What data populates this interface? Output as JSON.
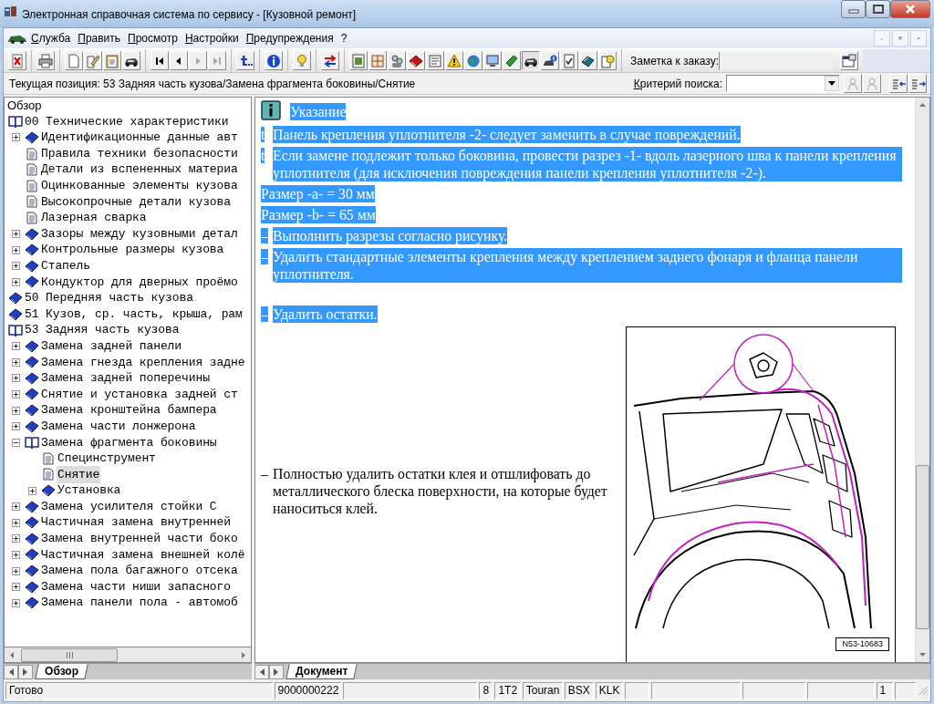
{
  "window": {
    "title": "Электронная справочная система по сервису - [Кузовной ремонт]"
  },
  "menu": [
    {
      "label": "Служба"
    },
    {
      "label": "Править"
    },
    {
      "label": "Просмотр"
    },
    {
      "label": "Настройки"
    },
    {
      "label": "Предупреждения"
    },
    {
      "label": "?"
    }
  ],
  "order_note": {
    "label": "Заметка к заказу:"
  },
  "position_bar": {
    "text": "Текущая позиция: 53 Задняя часть кузова/Замена фрагмента боковины/Снятие",
    "search_label": "Критерий поиска:"
  },
  "tree": {
    "header": "Обзор",
    "items": [
      {
        "label": "00 Технические характеристики",
        "kind": "book",
        "expanded": true,
        "selected": false,
        "children": [
          {
            "label": "Идентификационные данные авт",
            "kind": "book",
            "expanded": false,
            "selected": false
          },
          {
            "label": "Правила техники безопасности",
            "kind": "page",
            "selected": false
          },
          {
            "label": "Детали из вспененных материа",
            "kind": "page",
            "selected": false
          },
          {
            "label": "Оцинкованные элементы кузова",
            "kind": "page",
            "selected": false
          },
          {
            "label": "Высокопрочные детали кузова",
            "kind": "page",
            "selected": false
          },
          {
            "label": "Лазерная сварка",
            "kind": "page",
            "selected": false
          },
          {
            "label": "Зазоры между кузовными детал",
            "kind": "book",
            "expanded": false,
            "selected": false
          },
          {
            "label": "Контрольные размеры кузова",
            "kind": "book",
            "expanded": false,
            "selected": false
          },
          {
            "label": "Стапель",
            "kind": "book",
            "expanded": false,
            "selected": false
          },
          {
            "label": "Кондуктор для дверных проёмо",
            "kind": "book",
            "expanded": false,
            "selected": false
          }
        ]
      },
      {
        "label": "50 Передняя часть кузова",
        "kind": "book",
        "expanded": false,
        "selected": false
      },
      {
        "label": "51 Кузов, ср. часть, крыша, рам",
        "kind": "book",
        "expanded": false,
        "selected": false
      },
      {
        "label": "53 Задняя часть кузова",
        "kind": "book",
        "expanded": true,
        "selected": false,
        "children": [
          {
            "label": "Замена задней панели",
            "kind": "book",
            "expanded": false,
            "selected": false
          },
          {
            "label": "Замена гнезда крепления задне",
            "kind": "book",
            "expanded": false,
            "selected": false
          },
          {
            "label": "Замена задней поперечины",
            "kind": "book",
            "expanded": false,
            "selected": false
          },
          {
            "label": "Снятие и установка задней ст",
            "kind": "book",
            "expanded": false,
            "selected": false
          },
          {
            "label": "Замена кронштейна бампера",
            "kind": "book",
            "expanded": false,
            "selected": false
          },
          {
            "label": "Замена части лонжерона",
            "kind": "book",
            "expanded": false,
            "selected": false
          },
          {
            "label": "Замена фрагмента боковины",
            "kind": "book",
            "expanded": true,
            "selected": false,
            "children": [
              {
                "label": "Специнструмент",
                "kind": "page",
                "selected": false
              },
              {
                "label": "Снятие",
                "kind": "page",
                "selected": true
              },
              {
                "label": "Установка",
                "kind": "book",
                "expanded": false,
                "selected": false
              }
            ]
          },
          {
            "label": "Замена усилителя стойки С",
            "kind": "book",
            "expanded": false,
            "selected": false
          },
          {
            "label": "Частичная замена внутренней",
            "kind": "book",
            "expanded": false,
            "selected": false
          },
          {
            "label": "Замена внутренней части боко",
            "kind": "book",
            "expanded": false,
            "selected": false
          },
          {
            "label": "Частичная замена внешней колё",
            "kind": "book",
            "expanded": false,
            "selected": false
          },
          {
            "label": "Замена пола багажного отсека",
            "kind": "book",
            "expanded": false,
            "selected": false
          },
          {
            "label": "Замена части ниши запасного",
            "kind": "book",
            "expanded": false,
            "selected": false
          },
          {
            "label": "Замена панели пола - автомоб",
            "kind": "book",
            "expanded": false,
            "selected": false
          }
        ]
      }
    ]
  },
  "left_tab": {
    "label": "Обзор",
    "selected": true
  },
  "content": {
    "note_heading": {
      "text": "Указание",
      "selected": true
    },
    "blocks": [
      {
        "kind": "bullet",
        "marker": "t",
        "text": "Панель крепления уплотнителя -2- следует заменить в случае повреждений.",
        "selected": true
      },
      {
        "kind": "bullet",
        "marker": "t",
        "text": "Если замене подлежит только боковина, провести разрез -1- вдоль лазерного шва к панели крепления уплотнителя (для исключения повреждения панели крепления уплотнителя -2-).",
        "selected": true
      },
      {
        "kind": "plain",
        "text": "Размер -a- = 30 мм",
        "selected": true
      },
      {
        "kind": "plain",
        "text": "Размер -b- = 65 мм",
        "selected": true
      },
      {
        "kind": "bullet",
        "marker": "–",
        "text": "Выполнить разрезы согласно рисунку.",
        "selected": true
      },
      {
        "kind": "bullet",
        "marker": "–",
        "text": "Удалить стандартные элементы крепления между креплением заднего фонаря и фланца панели уплотнителя.",
        "selected": true
      },
      {
        "kind": "blank"
      },
      {
        "kind": "bullet",
        "marker": "–",
        "text": "Удалить остатки.",
        "selected": true
      }
    ],
    "figure_note": {
      "marker": "–",
      "text": "Полностью удалить остатки клея и отшлифовать до металлического блеска поверхности, на которые будет наноситься клей.",
      "selected": false
    },
    "figure": {
      "caption": "N53-10683"
    }
  },
  "document_tab": {
    "label": "Документ",
    "selected": true
  },
  "status_bar": {
    "message": "Готово",
    "fields": [
      "9000000222",
      "8",
      "1T2",
      "Touran",
      "BSX",
      "KLK",
      "1"
    ]
  }
}
